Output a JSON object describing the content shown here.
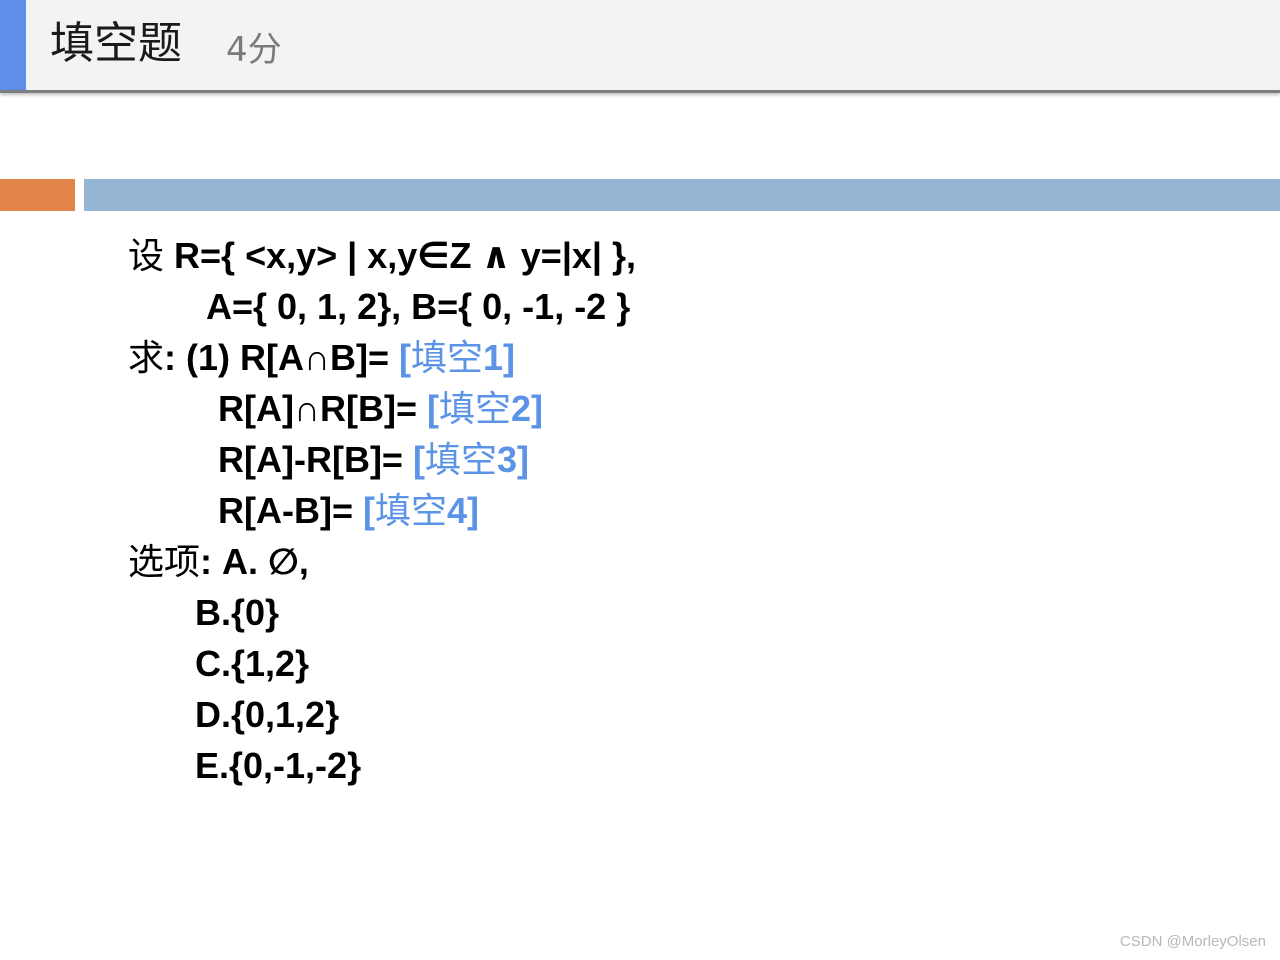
{
  "header": {
    "title": "填空题",
    "score": "4分",
    "accent_color": "#5d8fe8"
  },
  "decor": {
    "orange_band_color": "#e0844a",
    "blue_band_color": "#94b6d2"
  },
  "question": {
    "line1_prefix": "设",
    "line1_expr": "R={ <x,y> | x,y∈Z ∧ y=|x| },",
    "line2": "A={ 0, 1, 2}, B={ 0, -1, -2 }",
    "ask_prefix": "求",
    "items": [
      {
        "expr": ": (1) R[A∩B]= ",
        "blank_open": "[",
        "blank_word": "填空",
        "blank_num": "1]"
      },
      {
        "expr": "R[A]∩R[B]= ",
        "blank_open": "[",
        "blank_word": "填空",
        "blank_num": "2]"
      },
      {
        "expr": "R[A]-R[B]= ",
        "blank_open": "[",
        "blank_word": "填空",
        "blank_num": "3]"
      },
      {
        "expr": "R[A-B]= ",
        "blank_open": "[",
        "blank_word": "填空",
        "blank_num": "4]"
      }
    ],
    "blank_color": "#5b93e6"
  },
  "options": {
    "prefix": "选项",
    "first": ": A. ∅,",
    "rest": [
      "B.{0}",
      "C.{1,2}",
      "D.{0,1,2}",
      "E.{0,-1,-2}"
    ]
  },
  "watermark": "CSDN @MorleyOlsen"
}
